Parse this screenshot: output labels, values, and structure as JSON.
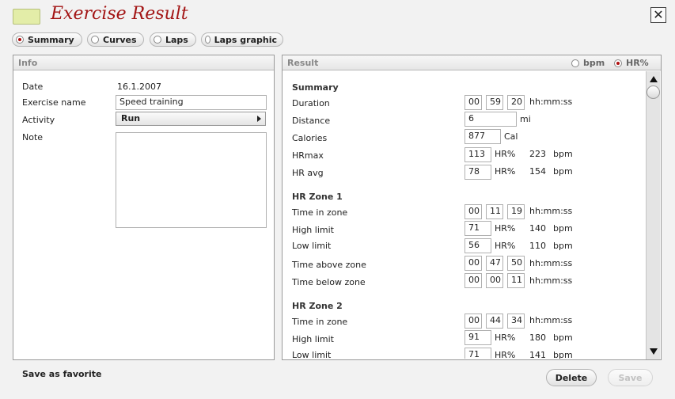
{
  "window": {
    "title": "Exercise Result",
    "close_glyph": "✕"
  },
  "tabs": [
    {
      "label": "Summary",
      "selected": true
    },
    {
      "label": "Curves",
      "selected": false
    },
    {
      "label": "Laps",
      "selected": false
    },
    {
      "label": "Laps graphic",
      "selected": false
    }
  ],
  "info": {
    "title": "Info",
    "date_label": "Date",
    "date_value": "16.1.2007",
    "name_label": "Exercise name",
    "name_value": "Speed training",
    "activity_label": "Activity",
    "activity_value": "Run",
    "note_label": "Note",
    "note_value": ""
  },
  "result": {
    "title": "Result",
    "unit_options": [
      {
        "label": "bpm",
        "selected": false
      },
      {
        "label": "HR%",
        "selected": true
      }
    ],
    "summary": {
      "heading": "Summary",
      "duration_label": "Duration",
      "duration": [
        "00",
        "59",
        "20"
      ],
      "time_unit": "hh:mm:ss",
      "distance_label": "Distance",
      "distance_value": "6",
      "distance_unit": "mi",
      "calories_label": "Calories",
      "calories_value": "877",
      "calories_unit": "Cal",
      "hrmax_label": "HRmax",
      "hrmax_value": "113",
      "hrmax_pct_unit": "HR%",
      "hrmax_bpm": "223",
      "hravg_label": "HR avg",
      "hravg_value": "78",
      "hravg_pct_unit": "HR%",
      "hravg_bpm": "154",
      "bpm_unit": "bpm"
    },
    "zone1": {
      "heading": "HR Zone 1",
      "time_in_label": "Time in zone",
      "time_in": [
        "00",
        "11",
        "19"
      ],
      "high_label": "High limit",
      "high_value": "71",
      "high_bpm": "140",
      "low_label": "Low limit",
      "low_value": "56",
      "low_bpm": "110",
      "above_label": "Time above zone",
      "above": [
        "00",
        "47",
        "50"
      ],
      "below_label": "Time below zone",
      "below": [
        "00",
        "00",
        "11"
      ]
    },
    "zone2": {
      "heading": "HR Zone 2",
      "time_in_label": "Time in zone",
      "time_in": [
        "00",
        "44",
        "34"
      ],
      "high_label": "High limit",
      "high_value": "91",
      "high_bpm": "180",
      "low_label": "Low limit",
      "low_value": "71",
      "low_bpm": "141"
    }
  },
  "footer": {
    "favorite_label": "Save as favorite",
    "delete_label": "Delete",
    "save_label": "Save"
  }
}
